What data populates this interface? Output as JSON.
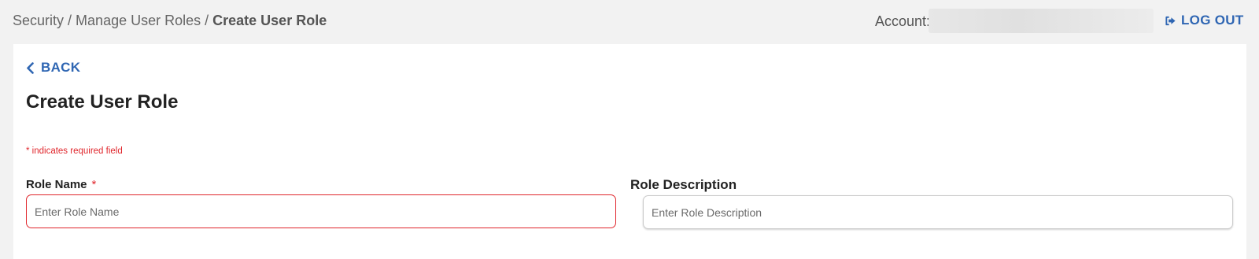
{
  "breadcrumb": {
    "items": [
      "Security",
      "Manage User Roles"
    ],
    "separator": "/",
    "current": "Create User Role"
  },
  "account": {
    "label": "Account:",
    "value": ""
  },
  "logout": {
    "label": "LOG OUT",
    "icon": "sign-out-icon"
  },
  "back": {
    "label": "BACK",
    "icon": "chevron-left-icon"
  },
  "page": {
    "title": "Create User Role",
    "required_note": "* indicates required field"
  },
  "form": {
    "role_name": {
      "label": "Role Name",
      "required_marker": "*",
      "placeholder": "Enter Role Name",
      "value": ""
    },
    "role_description": {
      "label": "Role Description",
      "placeholder": "Enter Role Description",
      "value": ""
    }
  },
  "colors": {
    "accent": "#2f66b3",
    "error": "#e0262c",
    "background": "#f2f2f2",
    "panel": "#ffffff"
  }
}
